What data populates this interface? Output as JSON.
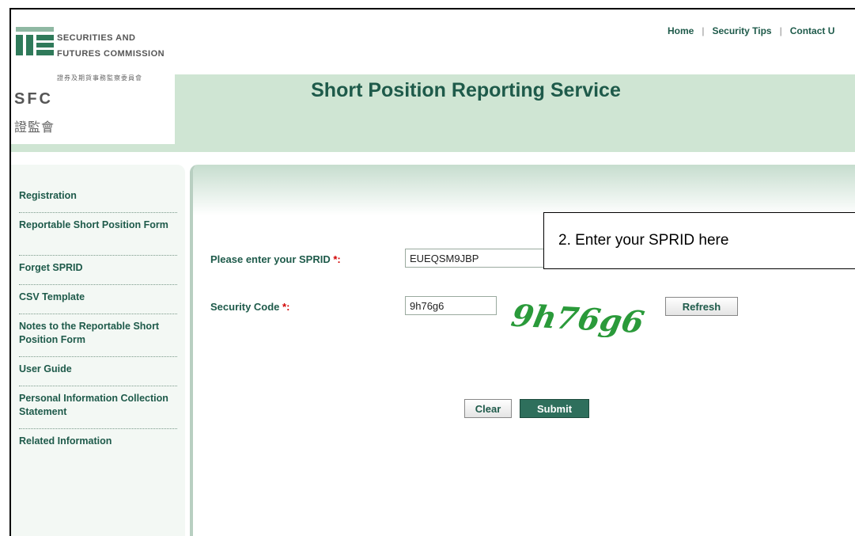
{
  "logo": {
    "en_line1": "SECURITIES AND",
    "en_line2": "FUTURES COMMISSION",
    "cn_full": "證券及期貨事務監察委員會",
    "abbr": "SFC",
    "cn_short": "證監會"
  },
  "site_title": "Short Position Reporting Service",
  "top_links": [
    "Home",
    "Security Tips",
    "Contact U"
  ],
  "sidebar": {
    "items": [
      {
        "label": "Registration"
      },
      {
        "label": "Reportable Short Position Form"
      },
      {
        "label": "Forget SPRID"
      },
      {
        "label": "CSV Template"
      },
      {
        "label": "Notes to the Reportable Short Position Form"
      },
      {
        "label": "User Guide"
      },
      {
        "label": "Personal Information Collection Statement"
      },
      {
        "label": "Related Information"
      }
    ]
  },
  "form": {
    "sprid_label": "Please enter your SPRID",
    "sprid_value": "EUEQSM9JBP",
    "security_code_label": "Security Code",
    "security_code_value": "9h76g6",
    "required_mark": "*",
    "label_colon": ":",
    "captcha_text": "9h76g6",
    "refresh_label": "Refresh",
    "clear_label": "Clear",
    "submit_label": "Submit"
  },
  "callout": {
    "text": "2. Enter your SPRID here"
  },
  "colors": {
    "brand_green": "#1e5a4a",
    "header_band": "#cfe5d3",
    "captcha_green": "#2a9a3a",
    "required_red": "#d10000"
  }
}
